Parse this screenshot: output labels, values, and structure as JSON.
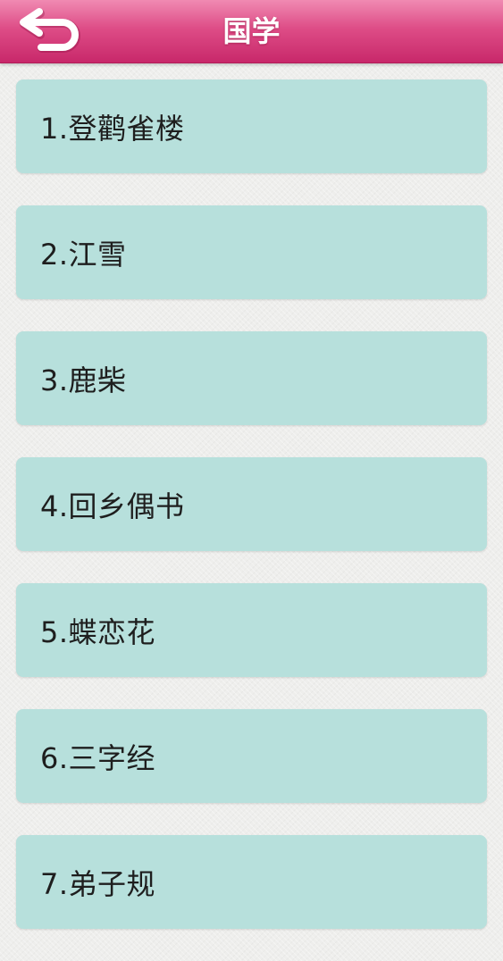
{
  "header": {
    "title": "国学",
    "back_icon": "undo-arrow-icon"
  },
  "list": {
    "items": [
      {
        "label": "1.登鹳雀楼"
      },
      {
        "label": "2.江雪"
      },
      {
        "label": "3.鹿柴"
      },
      {
        "label": "4.回乡偶书"
      },
      {
        "label": "5.蝶恋花"
      },
      {
        "label": "6.三字经"
      },
      {
        "label": "7.弟子规"
      }
    ]
  },
  "colors": {
    "header_top": "#f08ab2",
    "header_bottom": "#c8286a",
    "item_background": "#b7e0dc",
    "page_background": "#eeeeec",
    "title_text": "#ffffff",
    "item_text": "#1e1e1e"
  }
}
